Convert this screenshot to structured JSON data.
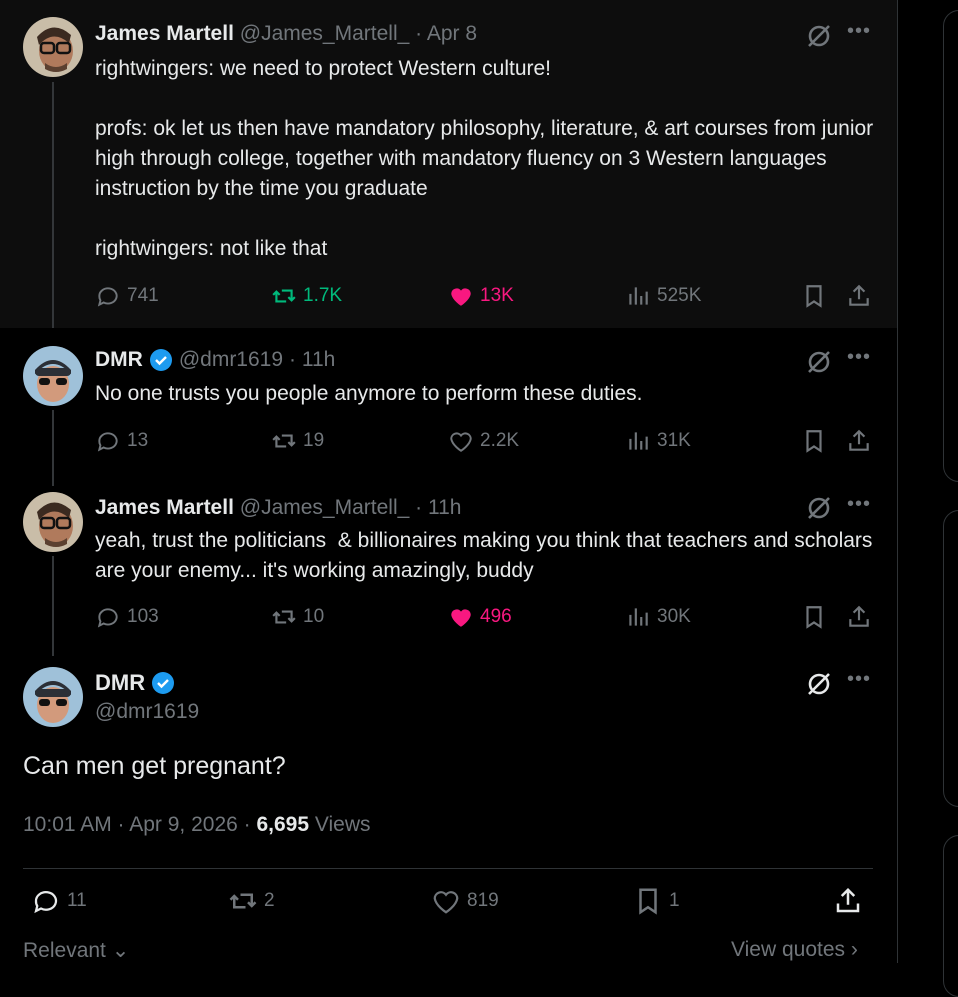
{
  "tweets": [
    {
      "name": "James Martell",
      "handle": "@James_Martell_",
      "time": "· Apr 8",
      "text": "rightwingers: we need to protect Western culture!\n\nprofs: ok let us then have mandatory philosophy, literature, & art courses from junior high through college, together with mandatory fluency on 3 Western languages instruction by the time you graduate\n\nrightwingers: not like that",
      "replies": "741",
      "reposts": "1.7K",
      "likes": "13K",
      "views": "525K"
    },
    {
      "name": "DMR",
      "handle": "@dmr1619",
      "time": "· 11h",
      "text": "No one trusts you people anymore to perform these duties.",
      "replies": "13",
      "reposts": "19",
      "likes": "2.2K",
      "views": "31K"
    },
    {
      "name": "James Martell",
      "handle": "@James_Martell_",
      "time": "· 11h",
      "text": "yeah, trust the politicians  & billionaires making you think that teachers and scholars are your enemy... it's working amazingly, buddy",
      "replies": "103",
      "reposts": "10",
      "likes": "496",
      "views": "30K"
    }
  ],
  "main": {
    "name": "DMR",
    "handle": "@dmr1619",
    "text": "Can men get pregnant?",
    "time": "10:01 AM · Apr 9, 2026 · ",
    "views_count": "6,695",
    "views_label": " Views",
    "replies": "11",
    "reposts": "2",
    "likes": "819",
    "bookmarks": "1"
  },
  "footer": {
    "sort": "Relevant",
    "quotes": "View quotes"
  },
  "colors": {
    "accent_green": "#00ba7c",
    "accent_pink": "#f91880",
    "verified": "#1d9bf0",
    "muted": "#71767b"
  }
}
